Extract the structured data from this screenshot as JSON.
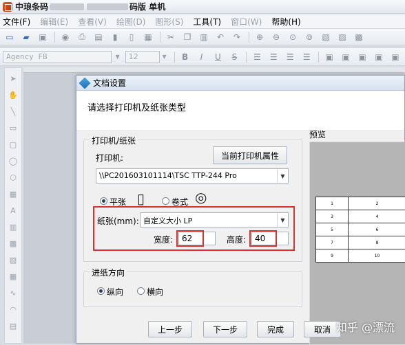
{
  "app": {
    "title_prefix": "中琅条码",
    "title_suffix": "码版 单机"
  },
  "menu": [
    {
      "label": "文件(F)",
      "dim": false
    },
    {
      "label": "编辑(E)",
      "dim": true
    },
    {
      "label": "查看(V)",
      "dim": true
    },
    {
      "label": "绘图(D)",
      "dim": true
    },
    {
      "label": "图形(S)",
      "dim": true
    },
    {
      "label": "工具(T)",
      "dim": false
    },
    {
      "label": "窗口(W)",
      "dim": true
    },
    {
      "label": "帮助(H)",
      "dim": false
    }
  ],
  "format_toolbar": {
    "font": "Agency FB",
    "size": "12",
    "bold": "B",
    "italic": "I",
    "underline": "U",
    "strike": "S"
  },
  "dialog": {
    "title": "文档设置",
    "header": "请选择打印机及纸张类型",
    "printer_group": "打印机/纸张",
    "printer_label": "打印机:",
    "printer_props_button": "当前打印机属性",
    "printer_value": "\\\\PC201603101114\\TSC TTP-244 Pro",
    "paper_flat": "平张",
    "paper_roll": "卷式",
    "paper_label": "纸张(mm):",
    "paper_value": "自定义大小 LP",
    "width_label": "宽度:",
    "width_value": "62",
    "height_label": "高度:",
    "height_value": "40",
    "feed_group": "进纸方向",
    "portrait": "纵向",
    "landscape": "横向",
    "preview_label": "预览",
    "preview_cells": [
      [
        "1",
        "2"
      ],
      [
        "3",
        "4"
      ],
      [
        "5",
        "6"
      ],
      [
        "7",
        "8"
      ],
      [
        "9",
        "10"
      ]
    ],
    "buttons": {
      "prev": "上一步",
      "next": "下一步",
      "finish": "完成",
      "cancel": "取消"
    }
  },
  "watermark": "知乎 @漂流",
  "colors": {
    "highlight": "#d8322e",
    "dialog_border": "#8fa3bd"
  }
}
